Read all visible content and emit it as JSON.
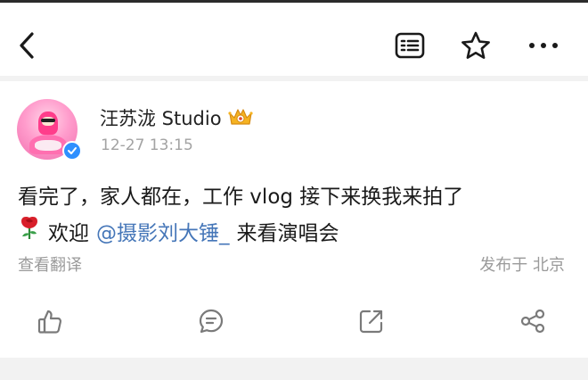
{
  "nav": {
    "back_icon": "chevron-left-icon",
    "list_icon": "list-icon",
    "favorite_icon": "star-icon",
    "more_icon": "more-dots-icon"
  },
  "post": {
    "author": {
      "name": "汪苏泷 Studio",
      "badge_icon": "crown-badge-icon",
      "verified_icon": "verified-check-icon",
      "verified_color": "#2f8ffe"
    },
    "timestamp": "12-27 13:15",
    "text_line1": "看完了，家人都在，工作 vlog 接下来换我来拍了",
    "text_line2_prefix": "欢迎",
    "mention": "@摄影刘大锤_",
    "text_line2_suffix": "来看演唱会",
    "emoji_icon": "rose-icon",
    "translate_label": "查看翻译",
    "location_label": "发布于 北京"
  },
  "actions": {
    "like_icon": "thumbs-up-icon",
    "comment_icon": "comment-icon",
    "share_icon": "repost-icon",
    "more_share_icon": "share-icon"
  },
  "colors": {
    "mention": "#4576b8",
    "secondary_text": "#9a9a9a",
    "background_band": "#f2f2f2"
  }
}
